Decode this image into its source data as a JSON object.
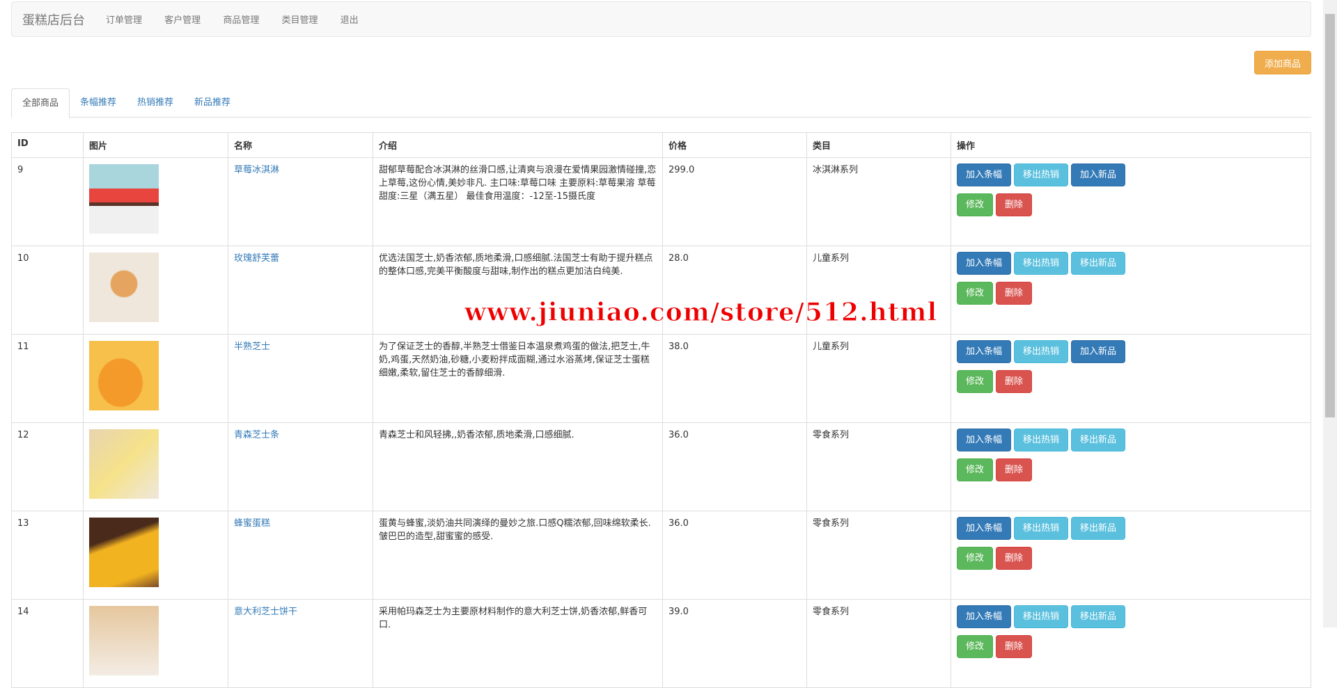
{
  "navbar": {
    "brand": "蛋糕店后台",
    "links": [
      "订单管理",
      "客户管理",
      "商品管理",
      "类目管理",
      "退出"
    ]
  },
  "add_button": "添加商品",
  "tabs": [
    "全部商品",
    "条幅推荐",
    "热销推荐",
    "新品推荐"
  ],
  "table": {
    "headers": [
      "ID",
      "图片",
      "名称",
      "介绍",
      "价格",
      "类目",
      "操作"
    ],
    "rows": [
      {
        "id": "9",
        "name": "草莓冰淇淋",
        "desc": "甜郁草莓配合冰淇淋的丝滑口感,让清爽与浪漫在爱情果园激情碰撞,恋上草莓,这份心情,美妙非凡. 主口味:草莓口味 主要原料:草莓果溶 草莓 甜度:三星（满五星） 最佳食用温度：-12至-15摄氏度",
        "price": "299.0",
        "category": "冰淇淋系列",
        "actions": [
          "加入条幅",
          "移出热销",
          "加入新品"
        ],
        "styles": [
          "primary",
          "info",
          "primary"
        ]
      },
      {
        "id": "10",
        "name": "玫瑰舒芙蕾",
        "desc": "优选法国芝士,奶香浓郁,质地柔滑,口感细腻.法国芝士有助于提升糕点的整体口感,完美平衡酸度与甜味,制作出的糕点更加洁白纯美.",
        "price": "28.0",
        "category": "儿童系列",
        "actions": [
          "加入条幅",
          "移出热销",
          "移出新品"
        ],
        "styles": [
          "primary",
          "info",
          "info"
        ]
      },
      {
        "id": "11",
        "name": "半熟芝士",
        "desc": "为了保证芝士的香醇,半熟芝士借鉴日本温泉煮鸡蛋的做法,把芝士,牛奶,鸡蛋,天然奶油,砂糖,小麦粉拌成面糊,通过水浴蒸烤,保证芝士蛋糕细嫩,柔软,留住芝士的香醇细滑.",
        "price": "38.0",
        "category": "儿童系列",
        "actions": [
          "加入条幅",
          "移出热销",
          "加入新品"
        ],
        "styles": [
          "primary",
          "info",
          "primary"
        ]
      },
      {
        "id": "12",
        "name": "青森芝士条",
        "desc": "青森芝士和风轻拂,,奶香浓郁,质地柔滑,口感细腻.",
        "price": "36.0",
        "category": "零食系列",
        "actions": [
          "加入条幅",
          "移出热销",
          "移出新品"
        ],
        "styles": [
          "primary",
          "info",
          "info"
        ]
      },
      {
        "id": "13",
        "name": "蜂蜜蛋糕",
        "desc": "蛋黄与蜂蜜,淡奶油共同演绎的曼妙之旅.口感Q糯浓郁,回味绵软柔长.皱巴巴的造型,甜蜜蜜的感受.",
        "price": "36.0",
        "category": "零食系列",
        "actions": [
          "加入条幅",
          "移出热销",
          "移出新品"
        ],
        "styles": [
          "primary",
          "info",
          "info"
        ]
      },
      {
        "id": "14",
        "name": "意大利芝士饼干",
        "desc": "采用帕玛森芝士为主要原材料制作的意大利芝士饼,奶香浓郁,鲜香可口.",
        "price": "39.0",
        "category": "零食系列",
        "actions": [
          "加入条幅",
          "移出热销",
          "移出新品"
        ],
        "styles": [
          "primary",
          "info",
          "info"
        ]
      }
    ],
    "edit_label": "修改",
    "delete_label": "删除"
  },
  "watermark": "www.jiuniao.com/store/512.html",
  "colors": {
    "primary": "#337ab7",
    "info": "#5bc0de",
    "success": "#5cb85c",
    "danger": "#d9534f",
    "warning": "#f0ad4e"
  }
}
